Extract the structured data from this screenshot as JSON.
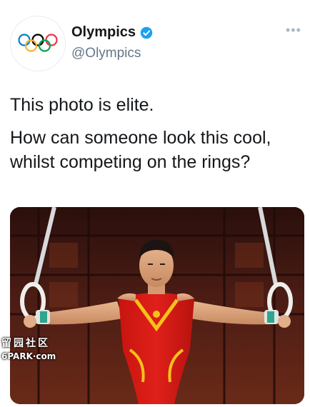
{
  "author": {
    "display_name": "Olympics",
    "handle": "@Olympics",
    "verified": true,
    "avatar_icon": "olympic-rings-icon",
    "verified_color": "#1da1f2"
  },
  "more_label": "•••",
  "tweet": {
    "line1": "This photo is elite.",
    "line2": "How can someone look this cool, whilst competing on the rings?"
  },
  "media": {
    "watermark_cn": "留园社区",
    "watermark_en": "6PARK·com"
  }
}
